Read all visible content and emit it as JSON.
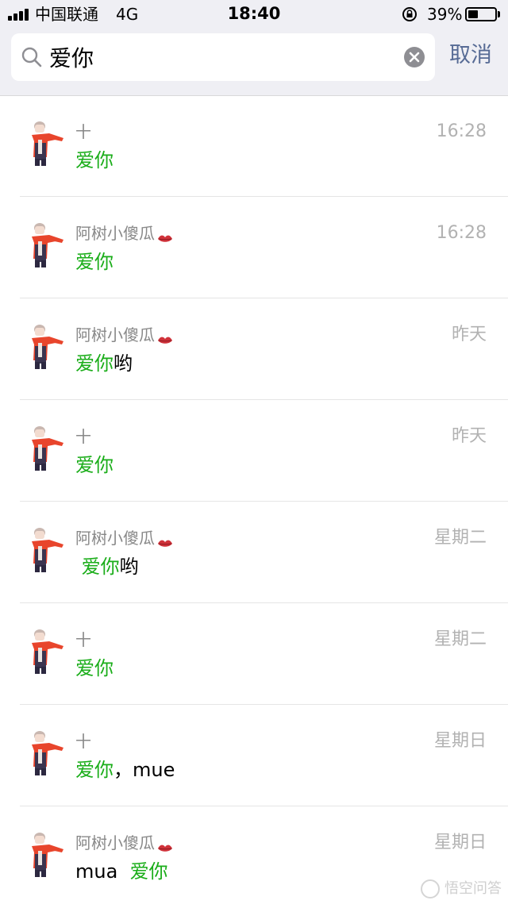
{
  "status_bar": {
    "carrier": "中国联通",
    "network": "4G",
    "time": "18:40",
    "battery_percent": "39%",
    "battery_level": 0.39
  },
  "search": {
    "query": "爱你",
    "cancel_label": "取消"
  },
  "results": [
    {
      "sender": "十",
      "has_kiss_icon": false,
      "time": "16:28",
      "before": "",
      "highlight": "爱你",
      "after": ""
    },
    {
      "sender": "阿树小傻瓜",
      "has_kiss_icon": true,
      "time": "16:28",
      "before": "",
      "highlight": "爱你",
      "after": ""
    },
    {
      "sender": "阿树小傻瓜",
      "has_kiss_icon": true,
      "time": "昨天",
      "before": "",
      "highlight": "爱你",
      "after": "哟"
    },
    {
      "sender": "十",
      "has_kiss_icon": false,
      "time": "昨天",
      "before": "",
      "highlight": "爱你",
      "after": ""
    },
    {
      "sender": "阿树小傻瓜",
      "has_kiss_icon": true,
      "time": "星期二",
      "before": " ",
      "highlight": "爱你",
      "after": "哟"
    },
    {
      "sender": "十",
      "has_kiss_icon": false,
      "time": "星期二",
      "before": "",
      "highlight": "爱你",
      "after": ""
    },
    {
      "sender": "十",
      "has_kiss_icon": false,
      "time": "星期日",
      "before": "",
      "highlight": "爱你",
      "after": "，mue"
    },
    {
      "sender": "阿树小傻瓜",
      "has_kiss_icon": true,
      "time": "星期日",
      "before": "mua  ",
      "highlight": "爱你",
      "after": ""
    }
  ],
  "watermark": "悟空问答",
  "colors": {
    "highlight": "#1aad19",
    "link": "#576b95",
    "header_bg": "#efeff4",
    "scarf": "#e8452c"
  }
}
